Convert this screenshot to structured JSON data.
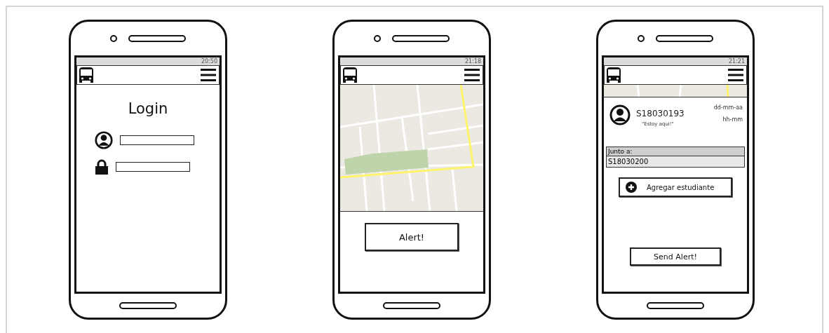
{
  "phones": [
    {
      "kind": "login",
      "status_time": "20:50",
      "title": "Login",
      "fields": [
        {
          "kind": "user"
        },
        {
          "kind": "password"
        }
      ]
    },
    {
      "kind": "map",
      "status_time": "21:18",
      "button": "Alert!"
    },
    {
      "kind": "alert",
      "status_time": "21:21",
      "student": "S18030193",
      "quote": "\"Estoy aqui!\"",
      "date": "dd-mm-aa",
      "time": "hh-mm",
      "group_label": "Junto a:",
      "group_value": "S18030200",
      "add_button": "Agregar estudiante",
      "send_button": "Send Alert!"
    }
  ]
}
